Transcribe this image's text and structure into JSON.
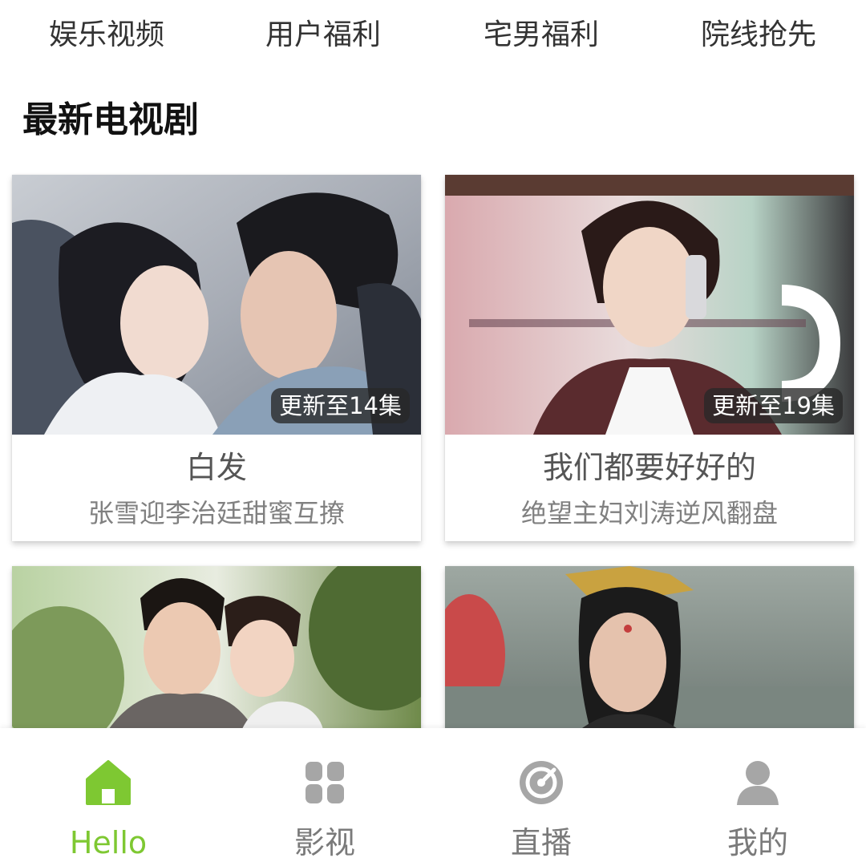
{
  "top_links": [
    "娱乐视频",
    "用户福利",
    "宅男福利",
    "院线抢先"
  ],
  "section_title": "最新电视剧",
  "cards": [
    {
      "title": "白发",
      "subtitle": "张雪迎李治廷甜蜜互撩",
      "badge": "更新至14集"
    },
    {
      "title": "我们都要好好的",
      "subtitle": "绝望主妇刘涛逆风翻盘",
      "badge": "更新至19集"
    },
    {
      "title": "",
      "subtitle": "",
      "badge": ""
    },
    {
      "title": "",
      "subtitle": "",
      "badge": ""
    }
  ],
  "bottom_nav": [
    {
      "label": "Hello",
      "icon": "home-icon",
      "active": true
    },
    {
      "label": "影视",
      "icon": "grid-icon",
      "active": false
    },
    {
      "label": "直播",
      "icon": "live-target-icon",
      "active": false
    },
    {
      "label": "我的",
      "icon": "user-icon",
      "active": false
    }
  ],
  "colors": {
    "accent": "#7ec832",
    "inactive": "#a6a6a6",
    "badge_bg": "#3a3a3a"
  }
}
